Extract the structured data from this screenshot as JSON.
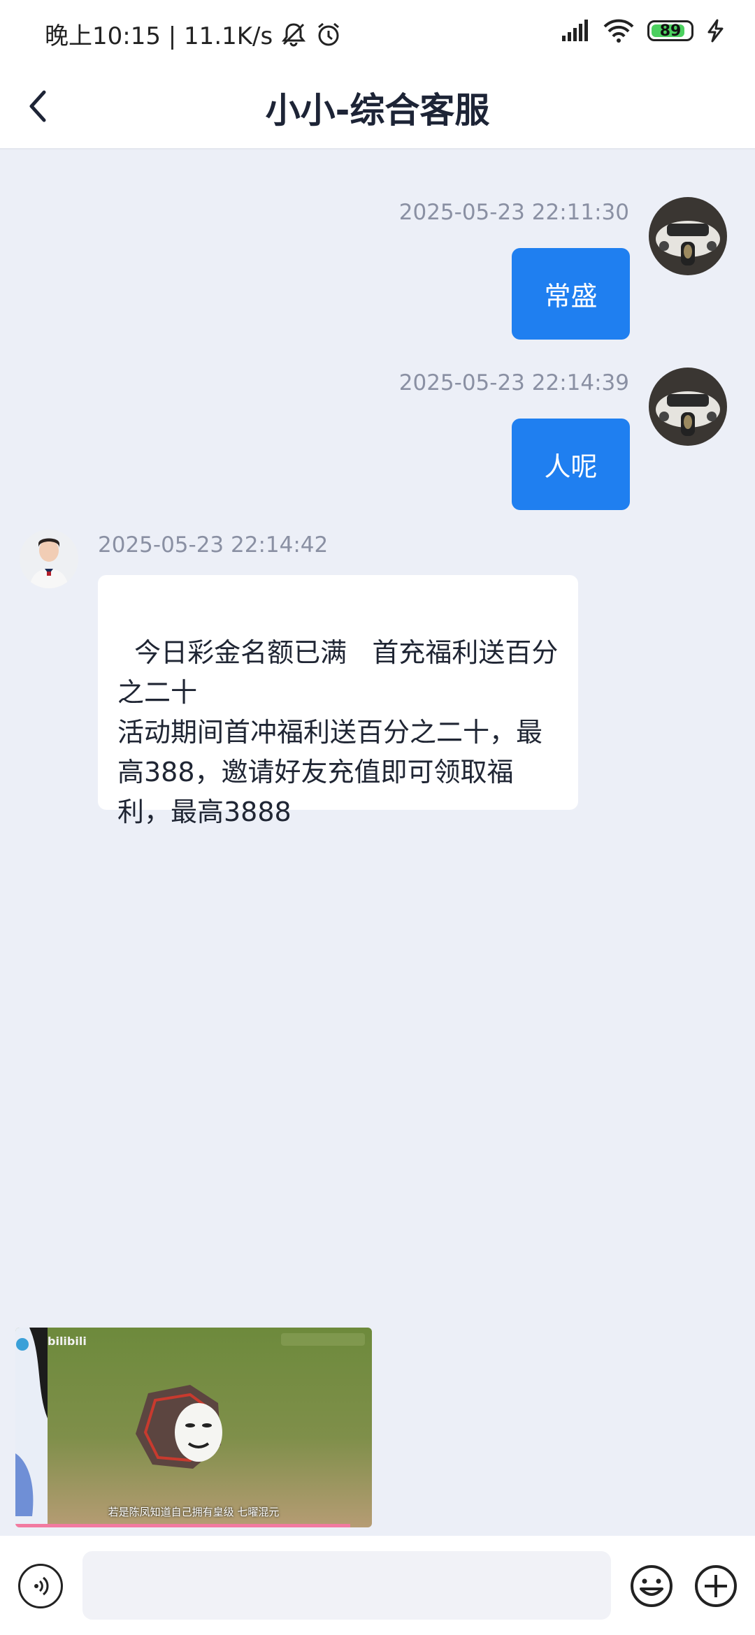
{
  "status_bar": {
    "time_text": "晚上10:15 | 11.1K/s",
    "battery": "89",
    "battery_level": 0.89
  },
  "header": {
    "title": "小小-综合客服"
  },
  "messages": [
    {
      "side": "outgoing",
      "timestamp": "2025-05-23 22:11:30",
      "text": "常盛"
    },
    {
      "side": "outgoing",
      "timestamp": "2025-05-23 22:14:39",
      "text": "人呢"
    },
    {
      "side": "incoming",
      "timestamp": "2025-05-23 22:14:42",
      "text": "今日彩金名额已满   首充福利送百分之二十\n活动期间首冲福利送百分之二十，最高388，邀请好友充值即可领取福利，最高3888"
    }
  ],
  "video": {
    "brand": "bilibili",
    "caption": "若是陈凤知道自己拥有皇级 七曜混元",
    "progress": 0.94
  },
  "input": {
    "placeholder": ""
  },
  "colors": {
    "accent": "#1f7ff0",
    "chat_background": "#eceff7"
  }
}
